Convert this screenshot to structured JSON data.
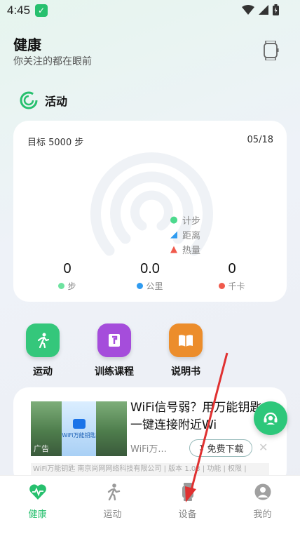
{
  "status_bar": {
    "time": "4:45"
  },
  "header": {
    "title": "健康",
    "subtitle": "你关注的都在眼前"
  },
  "activity_section": {
    "label": "活动"
  },
  "activity_card": {
    "goal": "目标 5000 步",
    "date": "05/18",
    "legend": [
      {
        "label": "计步",
        "icon": "footprint-icon",
        "color": "#4cd98d"
      },
      {
        "label": "距离",
        "icon": "distance-icon",
        "color": "#2f9bf0"
      },
      {
        "label": "热量",
        "icon": "flame-icon",
        "color": "#f05a4c"
      }
    ],
    "stats": [
      {
        "value": "0",
        "unit": "步",
        "color": "#6ee3a0"
      },
      {
        "value": "0.0",
        "unit": "公里",
        "color": "#2f9bf0"
      },
      {
        "value": "0",
        "unit": "千卡",
        "color": "#f05a4c"
      }
    ]
  },
  "shortcuts": [
    {
      "label": "运动",
      "icon": "run-icon",
      "color": "#34c77b"
    },
    {
      "label": "训练课程",
      "icon": "course-icon",
      "color": "#a54ddb"
    },
    {
      "label": "说明书",
      "icon": "book-icon",
      "color": "#ec8d2b"
    }
  ],
  "ad": {
    "headline": "WiFi信号弱？用万能钥匙一键连接附近Wi",
    "sub": "WiFi万...",
    "download_label": "免费下载",
    "tag": "广告",
    "thumb_name": "WiFi万能钥匙",
    "footer": "WiFi万能钥匙 南京尚网网络科技有限公司 | 版本 1.03 | 功能 | 权限 |"
  },
  "bottom_nav": [
    {
      "label": "健康",
      "icon": "heart-pulse-icon",
      "active": true
    },
    {
      "label": "运动",
      "icon": "run-icon",
      "active": false
    },
    {
      "label": "设备",
      "icon": "watch-icon",
      "active": false
    },
    {
      "label": "我的",
      "icon": "avatar-icon",
      "active": false
    }
  ],
  "colors": {
    "accent": "#27c06e",
    "annotation": "#e03131"
  }
}
